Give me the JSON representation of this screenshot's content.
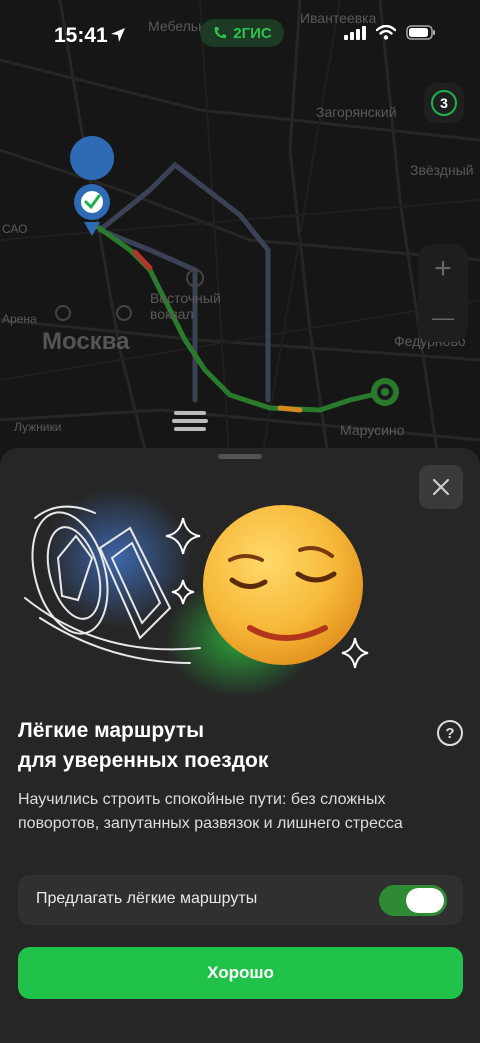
{
  "status_bar": {
    "time": "15:41",
    "app_badge": "2ГИС"
  },
  "map": {
    "labels": {
      "mebel_fabriki": "Мебельной фабрики",
      "ivanteevka": "Ивантеевка",
      "zagoryansky": "Загорянский",
      "zvyozdny": "Звёздный",
      "moskva": "Москва",
      "vostochny_vokzal": "Восточный вокзал",
      "fedurnovo": "Федурново",
      "marusino": "Марусино",
      "luzhniki": "Лужники",
      "arena": "Арена",
      "cao": "САО"
    },
    "route_badge": "3",
    "zoom_in": "+",
    "zoom_out": "—"
  },
  "sheet": {
    "title_line1": "Лёгкие маршруты",
    "title_line2": "для уверенных поездок",
    "help": "?",
    "description": "Научились строить спокойные пути: без сложных поворотов, запутанных развязок и лишнего стресса",
    "toggle_label": "Предлагать лёгкие маршруты",
    "toggle_on": true,
    "ok_button": "Хорошо"
  },
  "colors": {
    "accent_green": "#20c24a",
    "sheet_bg": "#262626",
    "map_bg": "#161616"
  }
}
